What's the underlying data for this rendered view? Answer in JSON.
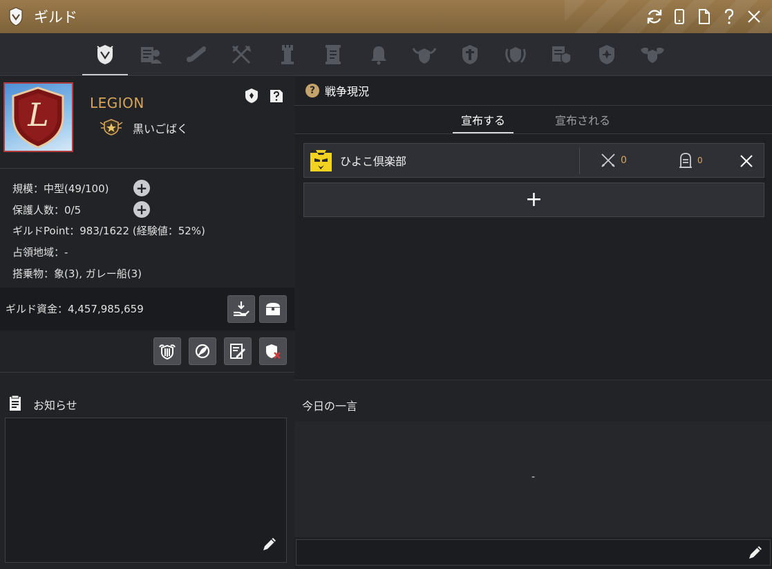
{
  "window": {
    "title": "ギルド"
  },
  "nav": {
    "tabs": [
      {
        "icon": "guild-shield-icon",
        "active": true
      },
      {
        "icon": "member-list-icon"
      },
      {
        "icon": "scroll-quest-icon"
      },
      {
        "icon": "crossed-axes-icon"
      },
      {
        "icon": "tower-icon"
      },
      {
        "icon": "parchment-icon"
      },
      {
        "icon": "bell-icon"
      },
      {
        "icon": "horned-crest-icon"
      },
      {
        "icon": "guard-shield-icon"
      },
      {
        "icon": "laurel-crest-icon"
      },
      {
        "icon": "scroll-shield-icon"
      },
      {
        "icon": "fleur-shield-icon"
      },
      {
        "icon": "winged-crest-icon"
      }
    ]
  },
  "guild": {
    "name": "LEGION",
    "master": "黒いごばく",
    "emblem_letter": "L",
    "info": {
      "scale": "規模：中型(49/100)",
      "protected": "保護人数：0/5",
      "points": "ギルドPoint：983/1622 (経験値：52%)",
      "territory": "占領地域：-",
      "vehicles": "搭乗物：象(3), ガレー船(3)"
    },
    "funds": "ギルド資金：4,457,985,659"
  },
  "notice": {
    "title": "お知らせ"
  },
  "war": {
    "title": "戦争現況",
    "help_glyph": "?",
    "tabs": {
      "declare": "宣布する",
      "declared": "宣布される"
    },
    "rows": [
      {
        "opponent": "ひよこ倶楽部",
        "kills": "0",
        "deaths": "0"
      }
    ],
    "add_glyph": "+"
  },
  "motto": {
    "title": "今日の一言",
    "text": "-"
  },
  "colors": {
    "accent": "#d8a45c",
    "titlebar": "#8a6d43",
    "panel": "#222327"
  }
}
